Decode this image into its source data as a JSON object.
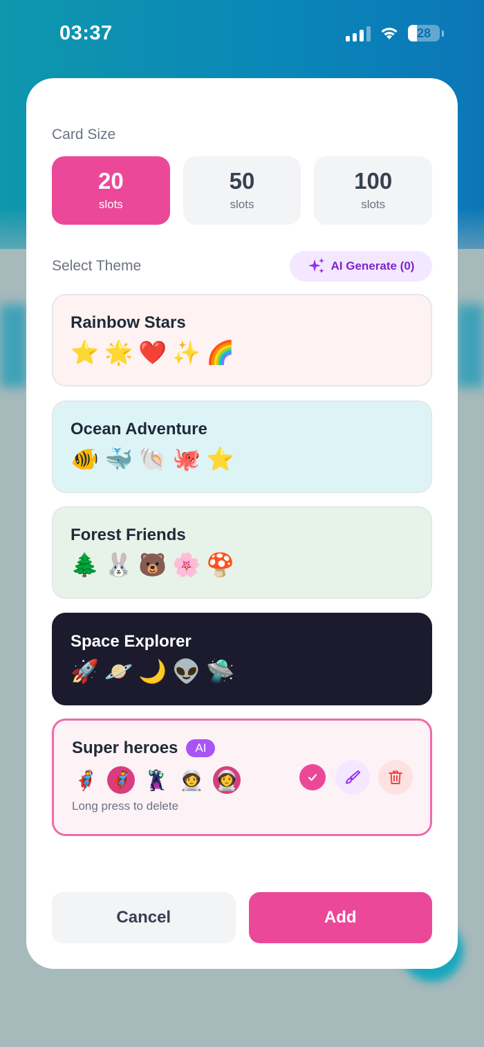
{
  "status": {
    "time": "03:37",
    "battery": "28",
    "battery_level_percent": 28,
    "icons": [
      "cellular-signal-icon",
      "wifi-icon",
      "battery-icon"
    ]
  },
  "card_size": {
    "label": "Card Size",
    "options": [
      {
        "value": "20",
        "unit": "slots",
        "selected": true
      },
      {
        "value": "50",
        "unit": "slots",
        "selected": false
      },
      {
        "value": "100",
        "unit": "slots",
        "selected": false
      }
    ]
  },
  "theme": {
    "label": "Select Theme",
    "ai_generate_label": "AI Generate (0)",
    "ai_generate_icon": "sparkles-icon",
    "items": [
      {
        "name": "Rainbow Stars",
        "emojis": [
          "⭐",
          "🌟",
          "❤️",
          "✨",
          "🌈"
        ]
      },
      {
        "name": "Ocean Adventure",
        "emojis": [
          "🐠",
          "🐳",
          "🐚",
          "🐙",
          "⭐"
        ]
      },
      {
        "name": "Forest Friends",
        "emojis": [
          "🌲",
          "🐰",
          "🐻",
          "🌸",
          "🍄"
        ]
      },
      {
        "name": "Space Explorer",
        "emojis": [
          "🚀",
          "🪐",
          "🌙",
          "👽",
          "🛸"
        ]
      }
    ],
    "custom": {
      "name": "Super heroes",
      "badge": "AI",
      "avatars": [
        "🦸",
        "🦸‍♂️",
        "🦹",
        "🧑‍🚀",
        "👩‍🚀"
      ],
      "hint": "Long press to delete",
      "selected": true
    }
  },
  "footer": {
    "cancel_label": "Cancel",
    "add_label": "Add"
  },
  "colors": {
    "accent": "#ec4899",
    "purple": "#a855f7"
  }
}
